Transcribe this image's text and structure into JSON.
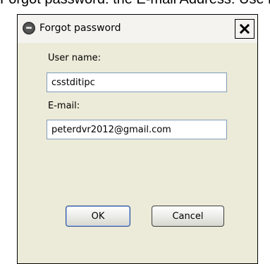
{
  "background_text": "Forgot password: the E-mail Address: Use nominated",
  "dialog": {
    "title": "Forgot password",
    "close_label": "✕",
    "fields": {
      "username_label": "User name:",
      "username_value": "csstditipc",
      "email_label": "E-mail:",
      "email_value": "peterdvr2012@gmail.com"
    },
    "buttons": {
      "ok": "OK",
      "cancel": "Cancel"
    }
  },
  "colors": {
    "dialog_body": "#ecead8",
    "titlebar": "#f4f3f0",
    "field_border": "#7f9db9"
  }
}
